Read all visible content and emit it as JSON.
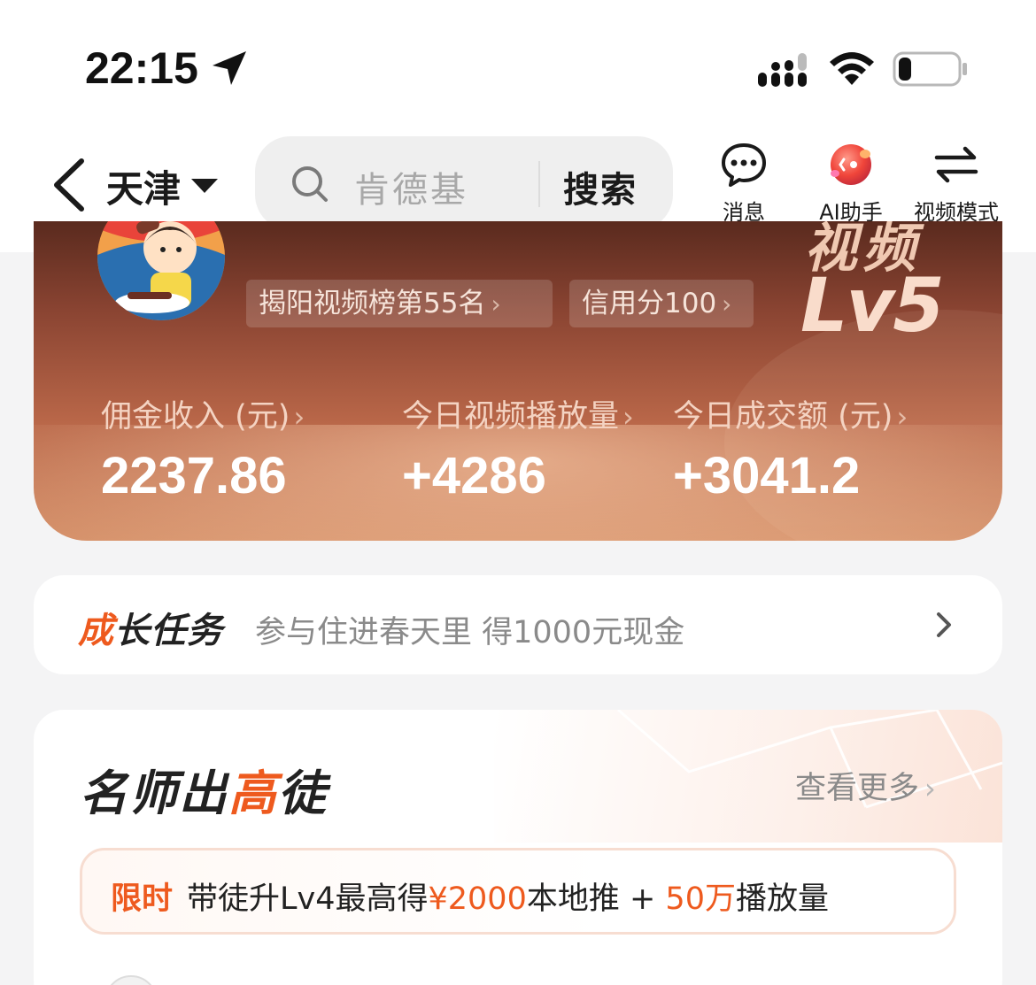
{
  "status_bar": {
    "time": "22:15",
    "icons": [
      "location-arrow-icon",
      "signal-icon",
      "wifi-icon",
      "battery-icon"
    ],
    "battery_level": 0.2
  },
  "nav": {
    "city": "天津",
    "search_placeholder": "肯德基",
    "search_button": "搜索",
    "actions": [
      {
        "label": "消息",
        "icon": "chat-bubble-icon"
      },
      {
        "label": "AI助手",
        "icon": "ai-assistant-icon"
      },
      {
        "label": "视频模式",
        "icon": "switch-arrows-icon"
      }
    ]
  },
  "earnings": {
    "rank_badge": "揭阳视频榜第55名",
    "credit_badge": "信用分100",
    "level_text": "Lv5",
    "level_top_text": "视频",
    "stats": [
      {
        "label": "佣金收入 (元)",
        "value": "2237.86"
      },
      {
        "label": "今日视频播放量",
        "value": "+4286"
      },
      {
        "label": "今日成交额 (元)",
        "value": "+3041.2"
      }
    ],
    "chevron": "›"
  },
  "growth_task": {
    "title_first": "成",
    "title_rest": "长任务",
    "description": "参与住进春天里 得1000元现金"
  },
  "mentor": {
    "title_part1": "名师出",
    "title_highlight": "高",
    "title_part2": "徒",
    "see_more": "查看更多",
    "promo": {
      "tag": "限时",
      "text1": "带徒升Lv4最高得",
      "highlight1": "¥2000",
      "text2": "本地推 + ",
      "highlight2": "50万",
      "text3": "播放量"
    }
  },
  "colors": {
    "accent": "#ee5a1e",
    "card_dark": "#5a2a1e",
    "card_light": "#d6926b",
    "background": "#f4f4f5"
  }
}
